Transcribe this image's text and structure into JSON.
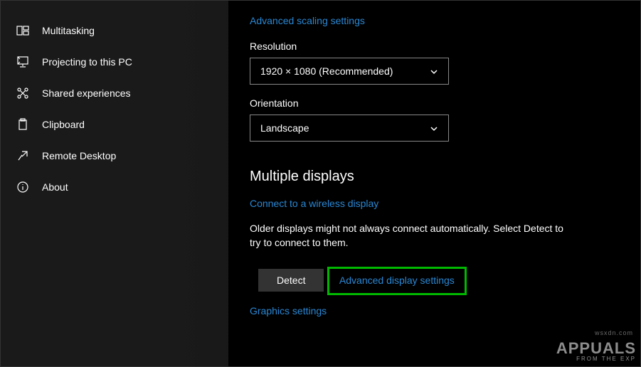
{
  "sidebar": {
    "items": [
      {
        "label": "Multitasking"
      },
      {
        "label": "Projecting to this PC"
      },
      {
        "label": "Shared experiences"
      },
      {
        "label": "Clipboard"
      },
      {
        "label": "Remote Desktop"
      },
      {
        "label": "About"
      }
    ]
  },
  "content": {
    "advanced_scaling_link": "Advanced scaling settings",
    "resolution_label": "Resolution",
    "resolution_value": "1920 × 1080 (Recommended)",
    "orientation_label": "Orientation",
    "orientation_value": "Landscape",
    "multiple_displays_heading": "Multiple displays",
    "wireless_link": "Connect to a wireless display",
    "older_text": "Older displays might not always connect automatically. Select Detect to try to connect to them.",
    "detect_button": "Detect",
    "advanced_display_link": "Advanced display settings",
    "graphics_link": "Graphics settings"
  },
  "watermark": {
    "main": "APPUALS",
    "sub": "FROM   THE   EXP",
    "tag": "wsxdn.com"
  }
}
